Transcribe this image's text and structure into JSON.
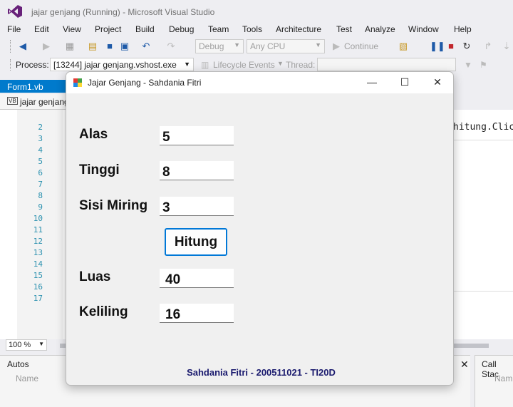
{
  "vs": {
    "title": "jajar genjang (Running) - Microsoft Visual Studio",
    "menu": [
      "File",
      "Edit",
      "View",
      "Project",
      "Build",
      "Debug",
      "Team",
      "Tools",
      "Architecture",
      "Test",
      "Analyze",
      "Window",
      "Help"
    ],
    "toolbar": {
      "config": "Debug",
      "platform": "Any CPU",
      "continue": "Continue"
    },
    "processbar": {
      "process_label": "Process:",
      "process_value": "[13244] jajar genjang.vshost.exe",
      "lifecycle": "Lifecycle Events",
      "thread_label": "Thread:"
    },
    "editor": {
      "tab": "Form1.vb",
      "nav": "jajar genjang",
      "line_numbers": [
        "2",
        "3",
        "4",
        "5",
        "6",
        "7",
        "8",
        "9",
        "10",
        "11",
        "12",
        "13",
        "14",
        "15",
        "16",
        "17"
      ],
      "code_fragment": "hitung.Click",
      "zoom": "100 %"
    },
    "panels": {
      "autos": "Autos",
      "autos_col": "Name",
      "callstack": "Call Stac",
      "callstack_col": "Nam"
    }
  },
  "form": {
    "title": "Jajar Genjang - Sahdania Fitri",
    "labels": {
      "alas": "Alas",
      "tinggi": "Tinggi",
      "sisi_miring": "Sisi Miring",
      "luas": "Luas",
      "keliling": "Keliling"
    },
    "values": {
      "alas": "5",
      "tinggi": "8",
      "sisi_miring": "3",
      "luas": "40",
      "keliling": "16"
    },
    "button": "Hitung",
    "footer": "Sahdania Fitri - 200511021 - TI20D"
  }
}
